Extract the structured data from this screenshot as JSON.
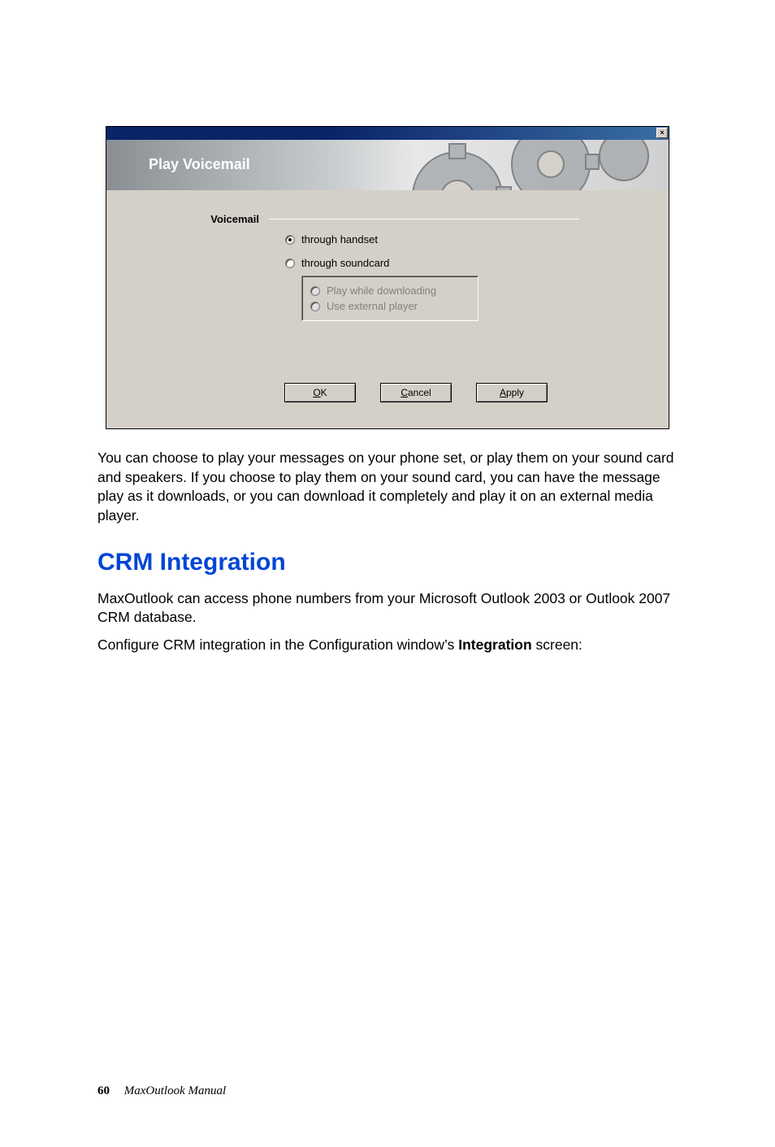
{
  "dialog": {
    "banner_title": "Play Voicemail",
    "close_glyph": "×",
    "section_label": "Voicemail",
    "options": {
      "handset": {
        "label": "through handset",
        "selected": true,
        "enabled": true
      },
      "soundcard": {
        "label": "through soundcard",
        "selected": false,
        "enabled": true
      },
      "play_downloading": {
        "label": "Play while downloading",
        "selected": false,
        "enabled": false
      },
      "external_player": {
        "label": "Use external player",
        "selected": false,
        "enabled": false
      }
    },
    "buttons": {
      "ok": "OK",
      "cancel": "Cancel",
      "apply": "Apply"
    }
  },
  "body": {
    "paragraph1": "You can choose to play your messages on your phone set, or play them on your sound card and speakers. If you choose to play them on your sound card, you can have the message play as it downloads, or you can download it completely and play it on an external media player.",
    "heading": "CRM Integration",
    "paragraph2": "MaxOutlook can access phone numbers from your Microsoft Outlook 2003 or Outlook 2007 CRM database.",
    "paragraph3_pre": "Configure CRM integration in the Configuration window’s ",
    "paragraph3_bold": "Integration",
    "paragraph3_post": " screen:"
  },
  "footer": {
    "page": "60",
    "title": "MaxOutlook Manual"
  }
}
